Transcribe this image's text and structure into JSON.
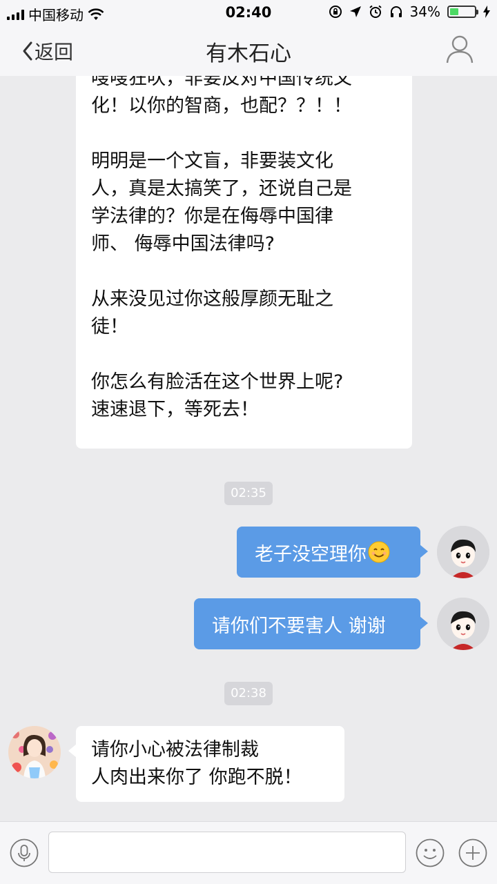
{
  "status_bar": {
    "carrier": "中国移动",
    "time": "02:40",
    "battery_percent": "34%",
    "battery_level": 0.34,
    "icons": [
      "signal-icon",
      "wifi-icon",
      "lock-rotation-icon",
      "location-icon",
      "alarm-icon",
      "headphones-icon",
      "battery-icon",
      "charging-icon"
    ]
  },
  "nav": {
    "back_label": "返回",
    "title": "有木石心",
    "profile_icon": "person-icon"
  },
  "messages": {
    "m1": {
      "sender": "contact",
      "paragraphs": [
        "嗖嗖狂吠，非要反对中国传统文\n化！以你的智商，也配？？！！",
        "明明是一个文盲，非要装文化\n人，真是太搞笑了，还说自己是\n学法律的？你是在侮辱中国律\n师、 侮辱中国法律吗?",
        "从来没见过你这般厚颜无耻之\n徒！",
        "你怎么有脸活在这个世界上呢?\n速速退下，等死去！"
      ]
    },
    "t1": "02:35",
    "m2": {
      "sender": "me",
      "text": "老子没空理你",
      "emoji": "smiling-face-emoji"
    },
    "m3": {
      "sender": "me",
      "text": "请你们不要害人 谢谢"
    },
    "t2": "02:38",
    "m4": {
      "sender": "contact",
      "paragraphs": [
        "请你小心被法律制裁\n人肉出来你了 你跑不脱！"
      ]
    }
  },
  "input_bar": {
    "placeholder": "",
    "value": "",
    "icons": [
      "microphone-icon",
      "emoji-icon",
      "plus-icon"
    ]
  },
  "colors": {
    "background": "#ebebed",
    "bar_background": "#f6f6f8",
    "my_bubble": "#5b9be6",
    "their_bubble": "#ffffff",
    "time_pill": "#d6d6da"
  }
}
